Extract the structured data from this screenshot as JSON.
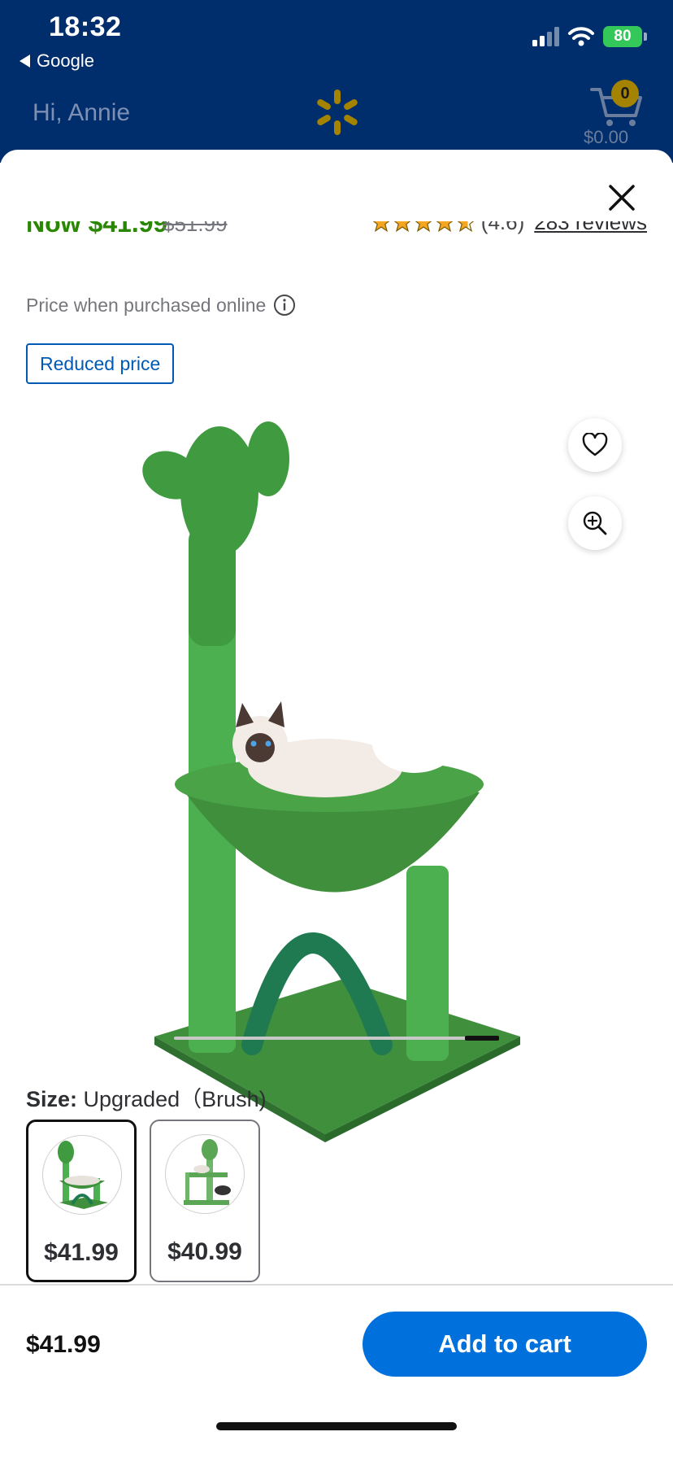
{
  "status_bar": {
    "time": "18:32",
    "back_label": "Google",
    "battery": "80"
  },
  "header": {
    "greeting": "Hi, Annie",
    "cart_count": "0",
    "cart_total": "$0.00"
  },
  "product": {
    "price_now": "Now $41.99",
    "price_was": "$51.99",
    "rating_value": "(4.6)",
    "rating_stars": 4.6,
    "reviews_label": "283 reviews",
    "price_note": "Price when purchased online",
    "badge": "Reduced price",
    "image_icons": [
      "heart-icon",
      "zoom-in-icon"
    ]
  },
  "size": {
    "label": "Size:",
    "value": "Upgraded（Brush)",
    "options": [
      {
        "price": "$41.99",
        "selected": true
      },
      {
        "price": "$40.99",
        "selected": false
      }
    ]
  },
  "bottom_bar": {
    "price": "$41.99",
    "add_to_cart": "Add to cart"
  },
  "colors": {
    "header_bg": "#002d6b",
    "price_green": "#2a8703",
    "primary_blue": "#0071dc",
    "spark_yellow": "#a48300"
  }
}
